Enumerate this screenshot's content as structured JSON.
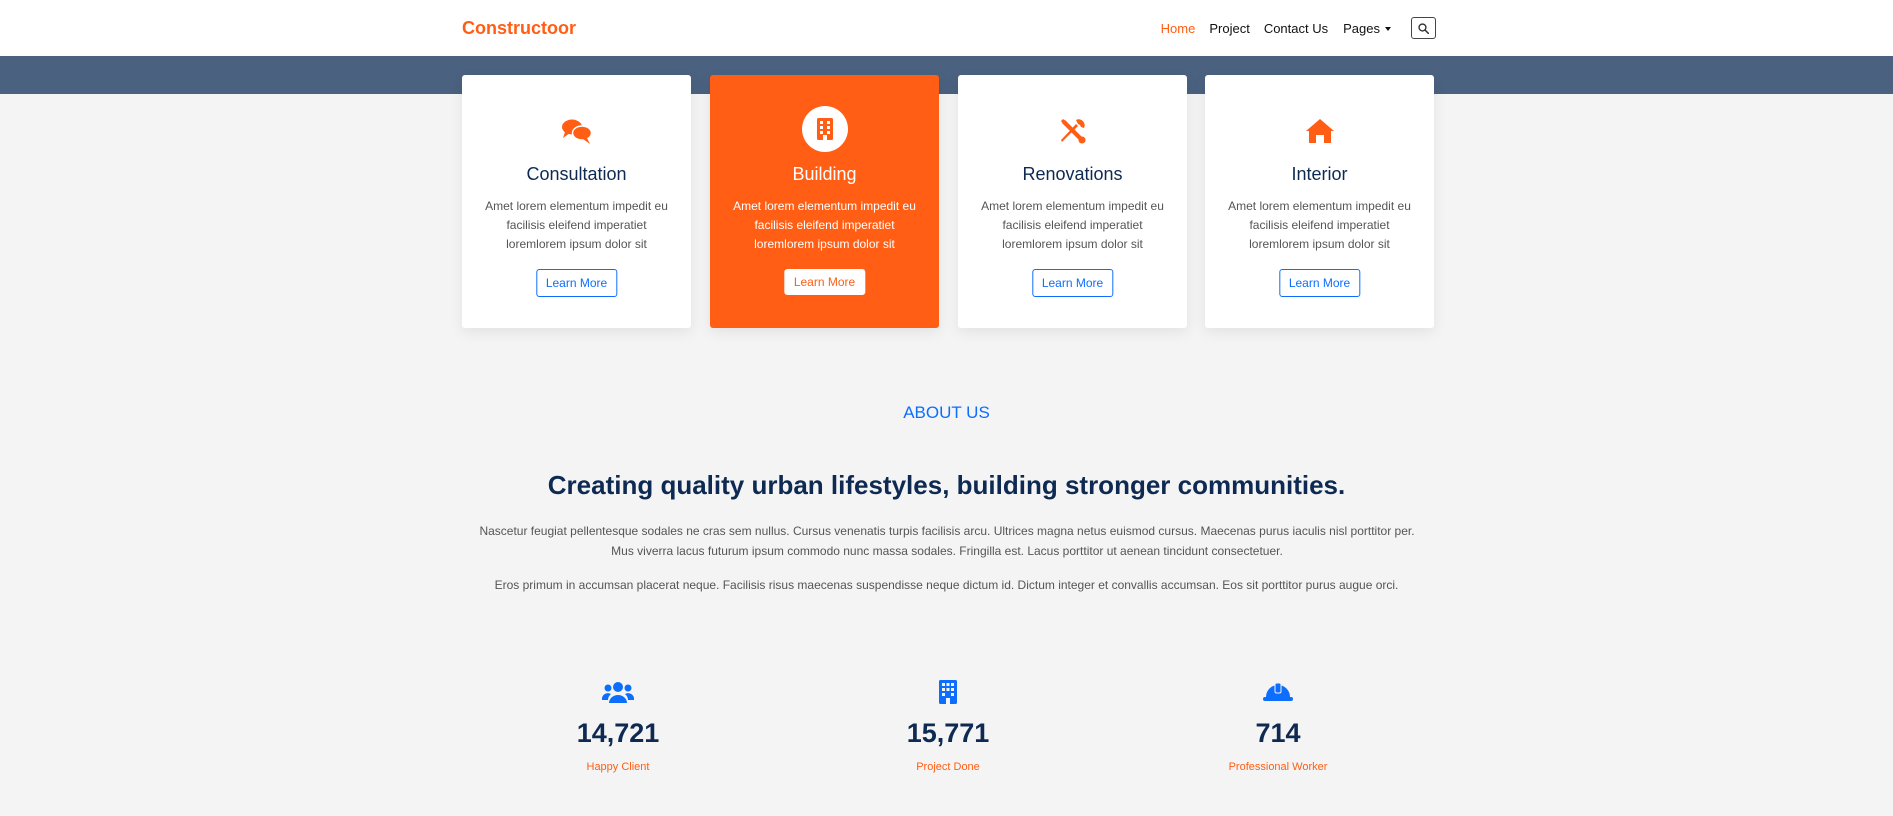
{
  "nav": {
    "brand": "Constructoor",
    "items": [
      {
        "label": "Home",
        "active": true
      },
      {
        "label": "Project"
      },
      {
        "label": "Contact Us"
      },
      {
        "label": "Pages"
      }
    ],
    "search_icon": "search-icon"
  },
  "services": [
    {
      "title": "Consultation",
      "text": "Amet lorem elementum impedit eu facilisis eleifend imperatiet loremlorem ipsum dolor sit",
      "button": "Learn More",
      "icon": "comments-icon"
    },
    {
      "title": "Building",
      "text": "Amet lorem elementum impedit eu facilisis eleifend imperatiet loremlorem ipsum dolor sit",
      "button": "Learn More",
      "icon": "building-icon"
    },
    {
      "title": "Renovations",
      "text": "Amet lorem elementum impedit eu facilisis eleifend imperatiet loremlorem ipsum dolor sit",
      "button": "Learn More",
      "icon": "tools-icon"
    },
    {
      "title": "Interior",
      "text": "Amet lorem elementum impedit eu facilisis eleifend imperatiet loremlorem ipsum dolor sit",
      "button": "Learn More",
      "icon": "home-icon"
    }
  ],
  "about": {
    "label": "ABOUT US",
    "heading": "Creating quality urban lifestyles, building stronger communities.",
    "p1": "Nascetur feugiat pellentesque sodales ne cras sem nullus. Cursus venenatis turpis facilisis arcu. Ultrices magna netus euismod cursus. Maecenas purus iaculis nisl porttitor per. Mus viverra lacus futurum ipsum commodo nunc massa sodales. Fringilla est. Lacus porttitor ut aenean tincidunt consectetuer.",
    "p2": "Eros primum in accumsan placerat neque. Facilisis risus maecenas suspendisse neque dictum id. Dictum integer et convallis accumsan. Eos sit porttitor purus augue orci."
  },
  "stats": [
    {
      "value": "14,721",
      "label": "Happy Client",
      "icon": "users-icon"
    },
    {
      "value": "15,771",
      "label": "Project Done",
      "icon": "building-icon"
    },
    {
      "value": "714",
      "label": "Professional Worker",
      "icon": "hard-hat-icon"
    }
  ],
  "colors": {
    "accent": "#ff5e14",
    "primary": "#0d6efd",
    "navy": "#0e2a52",
    "band": "#4a627f"
  }
}
